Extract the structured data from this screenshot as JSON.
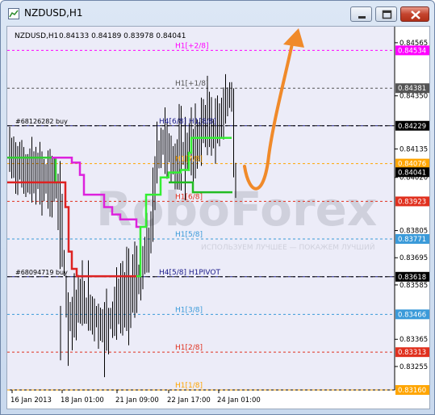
{
  "window": {
    "title": "NZDUSD,H1",
    "buttons": [
      "minimize",
      "maximize",
      "close"
    ]
  },
  "chart_header": {
    "symbol": "NZDUSD,H1",
    "ohlc": "0.84133 0.84189 0.83978 0.84041"
  },
  "watermark": "RoboForex",
  "chart_data": {
    "type": "candlestick",
    "symbol": "NZDUSD",
    "timeframe": "H1",
    "ylim": [
      0.8316,
      0.8463
    ],
    "price_ticks": [
      "0.84565",
      "0.84350",
      "0.84135",
      "0.84020",
      "0.83805",
      "0.83695",
      "0.83585",
      "0.83365",
      "0.83255"
    ],
    "highlighted_prices": [
      {
        "value": "0.84534",
        "color": "#ff00ff"
      },
      {
        "value": "0.84381",
        "color": "#555555"
      },
      {
        "value": "0.84229",
        "color": "#000000"
      },
      {
        "value": "0.84076",
        "color": "#ffa500"
      },
      {
        "value": "0.84041",
        "color": "#000000"
      },
      {
        "value": "0.83923",
        "color": "#e0301e"
      },
      {
        "value": "0.83771",
        "color": "#3a9ad9"
      },
      {
        "value": "0.83618",
        "color": "#000000"
      },
      {
        "value": "0.83466",
        "color": "#3a9ad9"
      },
      {
        "value": "0.83313",
        "color": "#e0301e"
      },
      {
        "value": "0.83160",
        "color": "#ffa500"
      }
    ],
    "level_labels": [
      {
        "text": "H1[+2/8]",
        "price": 0.84534,
        "color": "#ff00ff"
      },
      {
        "text": "H1[+1/8]",
        "price": 0.84381,
        "color": "#555555"
      },
      {
        "text": "H4[6/8] H1[8/8]",
        "price": 0.84229,
        "color": "#1a1a8a"
      },
      {
        "text": "H1[7/8]",
        "price": 0.84076,
        "color": "#ffa500"
      },
      {
        "text": "H1[6/8]",
        "price": 0.83923,
        "color": "#e0301e"
      },
      {
        "text": "H1[5/8]",
        "price": 0.83771,
        "color": "#3a9ad9"
      },
      {
        "text": "H4[5/8] H1PIVOT",
        "price": 0.83618,
        "color": "#1a1a8a"
      },
      {
        "text": "H1[3/8]",
        "price": 0.83466,
        "color": "#3a9ad9"
      },
      {
        "text": "H1[2/8]",
        "price": 0.83313,
        "color": "#e0301e"
      },
      {
        "text": "H1[1/8]",
        "price": 0.8316,
        "color": "#ffa500"
      }
    ],
    "orders": [
      {
        "text": "#68126282 buy",
        "price": 0.84229
      },
      {
        "text": "#68094719 buy",
        "price": 0.83618
      }
    ],
    "x_labels": [
      "16 Jan 2013",
      "18 Jan 01:00",
      "21 Jan 09:00",
      "22 Jan 17:00",
      "24 Jan 01:00"
    ],
    "annotation": "orange curved arrow pointing up toward 0.84534 level"
  }
}
